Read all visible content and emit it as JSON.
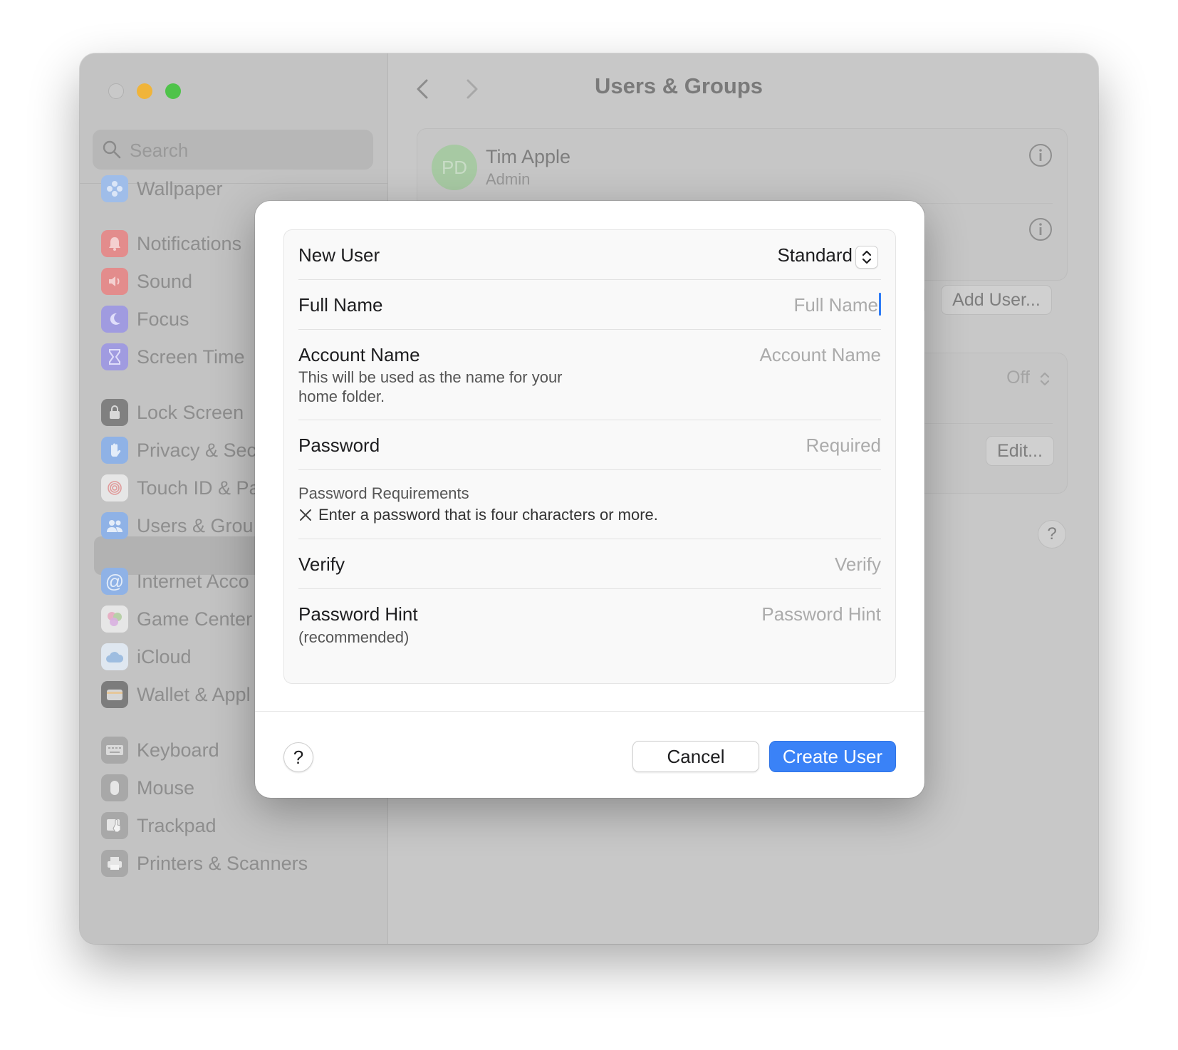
{
  "window": {
    "search_placeholder": "Search",
    "title": "Users & Groups"
  },
  "sidebar": {
    "items": [
      {
        "label": "Wallpaper",
        "icon": "wallpaper-icon",
        "color": "#8fb2e6"
      },
      {
        "label": "Notifications",
        "icon": "bell-icon",
        "color": "#e88989"
      },
      {
        "label": "Sound",
        "icon": "speaker-icon",
        "color": "#e88989"
      },
      {
        "label": "Focus",
        "icon": "moon-icon",
        "color": "#9b96e0"
      },
      {
        "label": "Screen Time",
        "icon": "hourglass-icon",
        "color": "#9b96e0"
      },
      {
        "label": "Lock Screen",
        "icon": "lock-icon",
        "color": "#7c7c7c"
      },
      {
        "label": "Privacy & Sec",
        "icon": "hand-icon",
        "color": "#8fb2e6"
      },
      {
        "label": "Touch ID & Pa",
        "icon": "fingerprint-icon",
        "color": "#e0e0e0"
      },
      {
        "label": "Users & Grou",
        "icon": "users-icon",
        "color": "#8fb2e6"
      },
      {
        "label": "Internet Acco",
        "icon": "at-icon",
        "color": "#8fb2e6"
      },
      {
        "label": "Game Center",
        "icon": "game-center-icon",
        "color": "#e0a8c8"
      },
      {
        "label": "iCloud",
        "icon": "cloud-icon",
        "color": "#b9cfe8"
      },
      {
        "label": "Wallet & Appl",
        "icon": "wallet-icon",
        "color": "#8c8c8c"
      },
      {
        "label": "Keyboard",
        "icon": "keyboard-icon",
        "color": "#a6a6a6"
      },
      {
        "label": "Mouse",
        "icon": "mouse-icon",
        "color": "#a6a6a6"
      },
      {
        "label": "Trackpad",
        "icon": "trackpad-icon",
        "color": "#a6a6a6"
      },
      {
        "label": "Printers & Scanners",
        "icon": "printer-icon",
        "color": "#a6a6a6"
      }
    ]
  },
  "main": {
    "user": {
      "initials": "PD",
      "name": "Tim Apple",
      "role": "Admin"
    },
    "add_user_label": "Add User...",
    "partial_button_label": ".",
    "off_label": "Off",
    "edit_label": "Edit...",
    "help_label": "?"
  },
  "dialog": {
    "new_user_label": "New User",
    "account_type": "Standard",
    "full_name_label": "Full Name",
    "full_name_placeholder": "Full Name",
    "account_name_label": "Account Name",
    "account_name_help_1": "This will be used as the name for your",
    "account_name_help_2": "home folder.",
    "account_name_placeholder": "Account Name",
    "password_label": "Password",
    "password_placeholder": "Required",
    "requirements_title": "Password Requirements",
    "requirement_text": "Enter a password that is four characters or more.",
    "verify_label": "Verify",
    "verify_placeholder": "Verify",
    "hint_label": "Password Hint",
    "hint_sublabel": "(recommended)",
    "hint_placeholder": "Password Hint",
    "help_label": "?",
    "cancel_label": "Cancel",
    "create_label": "Create User",
    "accent_color": "#3a82f7"
  }
}
